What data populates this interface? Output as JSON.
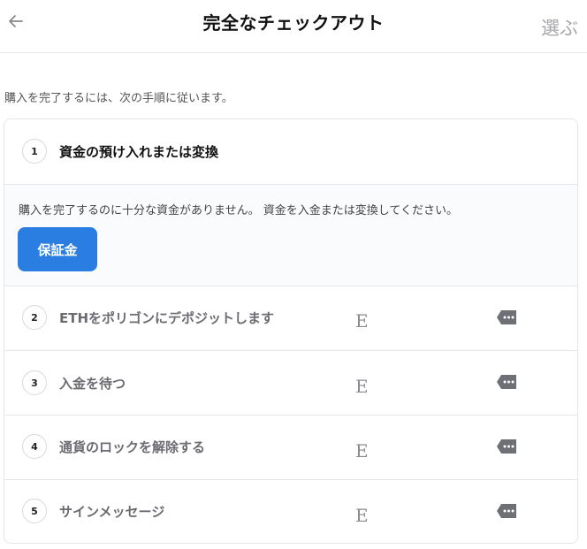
{
  "header": {
    "title": "完全なチェックアウト",
    "action_label": "選ぶ"
  },
  "intro": "購入を完了するには、次の手順に従います。",
  "steps": [
    {
      "number": "1",
      "label": "資金の預け入れまたは変換",
      "message": "購入を完了するのに十分な資金がありません。 資金を入金または変換してください。",
      "button_label": "保証金"
    },
    {
      "number": "2",
      "label": "ETHをポリゴンにデポジットします",
      "status": "E"
    },
    {
      "number": "3",
      "label": "入金を待つ",
      "status": "E"
    },
    {
      "number": "4",
      "label": "通貨のロックを解除する",
      "status": "E"
    },
    {
      "number": "5",
      "label": "サインメッセージ",
      "status": "E"
    }
  ],
  "icons": {
    "back": "arrow-left-icon",
    "menu": "more-tag-icon"
  },
  "colors": {
    "accent": "#2a7de1",
    "muted_text": "#6b6b72",
    "border": "#e6e6ea"
  }
}
